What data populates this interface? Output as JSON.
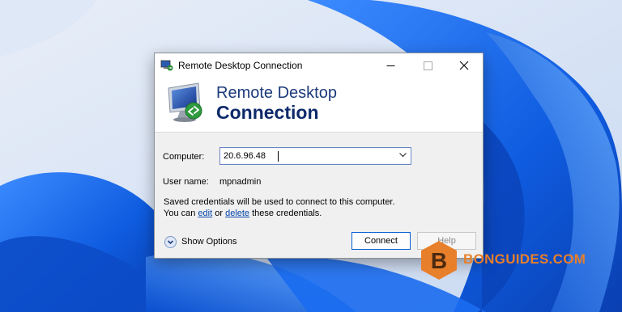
{
  "window": {
    "title": "Remote Desktop Connection",
    "banner_line1": "Remote Desktop",
    "banner_line2": "Connection",
    "icon": "remote-desktop-icon"
  },
  "titlebar_controls": [
    "minimize-icon",
    "maximize-icon",
    "close-icon"
  ],
  "form": {
    "computer_label": "Computer:",
    "computer_value": "20.6.96.48",
    "username_label": "User name:",
    "username_value": "mpnadmin",
    "credentials_line1": "Saved credentials will be used to connect to this computer.",
    "credentials_prefix": "You can ",
    "edit_link": "edit",
    "or_text": " or ",
    "delete_link": "delete",
    "credentials_suffix": " these credentials."
  },
  "footer": {
    "show_options": "Show Options",
    "connect_button": "Connect",
    "help_button": "Help"
  },
  "watermark": {
    "text": "BONGUIDES.COM",
    "logo_letter": "B",
    "color": "#e87f2b"
  },
  "colors": {
    "wallpaper_blue": "#1467e6",
    "banner_title": "#0e2a6b",
    "link": "#0645ad",
    "connect_border": "#0a5fd3"
  }
}
